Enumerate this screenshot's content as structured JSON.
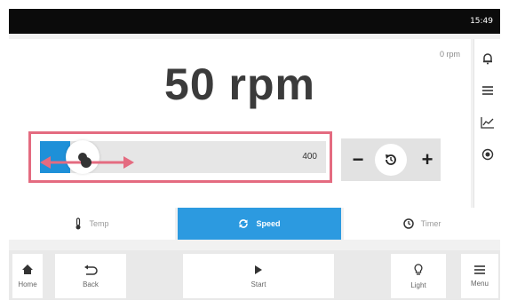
{
  "status_bar": {
    "time": "15:49"
  },
  "speed_display": {
    "setpoint": "50 rpm",
    "actual": "0 rpm"
  },
  "slider": {
    "max_label": "400",
    "value_fraction": 0.125
  },
  "stepper": {
    "minus": "−",
    "plus": "+"
  },
  "tabs": [
    {
      "label": "Temp",
      "icon": "thermometer-icon",
      "active": false
    },
    {
      "label": "Speed",
      "icon": "refresh-icon",
      "active": true
    },
    {
      "label": "Timer",
      "icon": "clock-icon",
      "active": false
    }
  ],
  "side_toolbar": [
    "bell-icon",
    "list-icon",
    "chart-icon",
    "record-icon"
  ],
  "bottom_bar": {
    "home": "Home",
    "back": "Back",
    "start": "Start",
    "light": "Light",
    "menu": "Menu"
  },
  "colors": {
    "accent": "#2c9ae0",
    "highlight": "#e46b80",
    "status_bar": "#0b0b0b"
  }
}
